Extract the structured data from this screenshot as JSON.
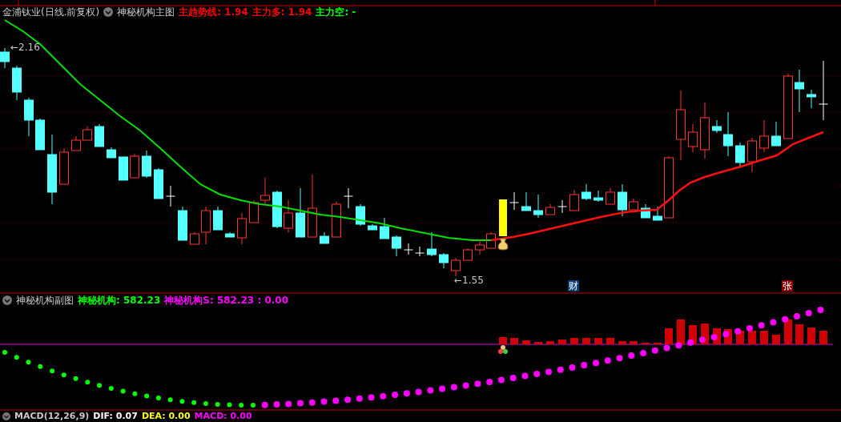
{
  "main_header": {
    "stock": "金浦钛业(日线.前复权)",
    "indicator": "神秘机构主图",
    "values": [
      {
        "label": "主趋势线: 1.94",
        "color": "#ff0000"
      },
      {
        "label": "主力多: 1.94",
        "color": "#ff0000"
      },
      {
        "label": "主力空: -",
        "color": "#00ff00"
      }
    ]
  },
  "price_labels": [
    {
      "kind": "high",
      "text": "←2.16"
    },
    {
      "kind": "low",
      "text": "←1.55"
    }
  ],
  "markers": [
    {
      "text": "财",
      "color": "#0b3f7a"
    },
    {
      "text": "张",
      "color": "#8b0000"
    }
  ],
  "sub_header": {
    "indicator": "神秘机构副图",
    "values": [
      {
        "label": "神秘机构: 582.23",
        "color": "#00ff00"
      },
      {
        "label": "神秘机构S: 582.23 : 0.00",
        "color": "#ff00ff"
      }
    ]
  },
  "bottom_header": {
    "values": [
      {
        "label": "MACD(12,26,9)",
        "color": "#c8c8c8"
      },
      {
        "label": "DIF: 0.07",
        "color": "#ffffff"
      },
      {
        "label": "DEA: 0.00",
        "color": "#ffff00"
      },
      {
        "label": "MACD: 0.00",
        "color": "#ff00ff"
      }
    ]
  }
}
